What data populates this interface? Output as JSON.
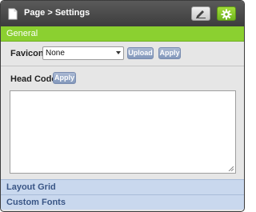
{
  "window": {
    "title": "Page > Settings",
    "icons": {
      "page": "page-icon",
      "edit": "pencil-icon",
      "settings": "gear-icon"
    }
  },
  "sections": {
    "general": {
      "label": "General"
    },
    "layout_grid": {
      "label": "Layout Grid"
    },
    "custom_fonts": {
      "label": "Custom Fonts"
    }
  },
  "favicon": {
    "label": "Favicon",
    "selected": "None",
    "upload_label": "Upload",
    "apply_label": "Apply"
  },
  "head_code": {
    "label": "Head Code",
    "apply_label": "Apply",
    "value": ""
  },
  "colors": {
    "titlebar": "#3d3d3d",
    "accent_green": "#8bd030",
    "button_blue": "#8398bb",
    "accordion_bg": "#c9d8ee",
    "accordion_text": "#3a5686"
  }
}
